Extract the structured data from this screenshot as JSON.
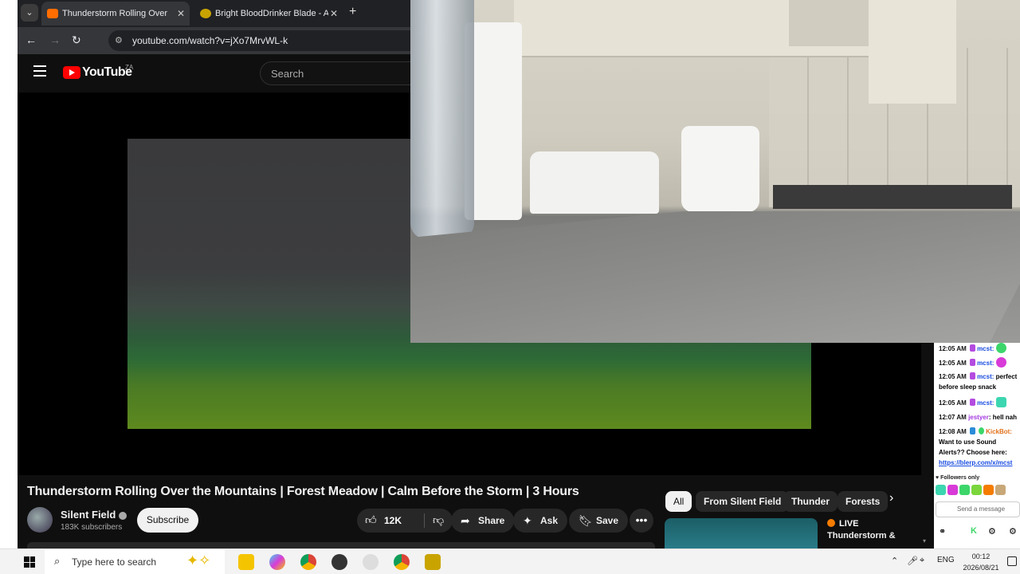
{
  "browser": {
    "tabs": [
      {
        "title": "Thunderstorm Rolling Over",
        "active": true
      },
      {
        "title": "Bright BloodDrinker Blade - AQ",
        "active": false
      }
    ],
    "url": "youtube.com/watch?v=jXo7MrvWL-k"
  },
  "youtube": {
    "logo_text": "YouTube",
    "region": "ZA",
    "search_placeholder": "Search",
    "video_title": "Thunderstorm Rolling Over the Mountains | Forest Meadow | Calm Before the Storm | 3 Hours",
    "channel": {
      "name": "Silent Field",
      "subscribers": "183K subscribers"
    },
    "subscribe_label": "Subscribe",
    "likes": "12K",
    "share_label": "Share",
    "ask_label": "Ask",
    "save_label": "Save",
    "chips": [
      "All",
      "From Silent Field",
      "Thunder",
      "Forests"
    ],
    "recommended": {
      "badge": "LIVE",
      "title": "Thunderstorm &"
    }
  },
  "chat": {
    "messages": [
      {
        "time": "12:05 AM",
        "user": "mcst:",
        "text": ""
      },
      {
        "time": "12:05 AM",
        "user": "mcst:",
        "text": ""
      },
      {
        "time": "12:05 AM",
        "user": "mcst:",
        "text": "perfect before sleep snack"
      },
      {
        "time": "12:05 AM",
        "user": "mcst:",
        "text": ""
      },
      {
        "time": "12:07 AM",
        "user": "jestyer",
        "text": ": hell nah"
      },
      {
        "time": "12:08 AM",
        "user": "KickBot:",
        "text": "Want to use Sound Alerts?? Choose here:",
        "link": "https://blerp.com/x/mcst"
      }
    ],
    "followers_only": "Followers only",
    "send_placeholder": "Send a message"
  },
  "taskbar": {
    "search_placeholder": "Type here to search",
    "language": "ENG",
    "time": "00:12",
    "date": "2026/08/21"
  },
  "colors": {
    "yt_red": "#ff0000",
    "kick_green": "#53fc18"
  }
}
